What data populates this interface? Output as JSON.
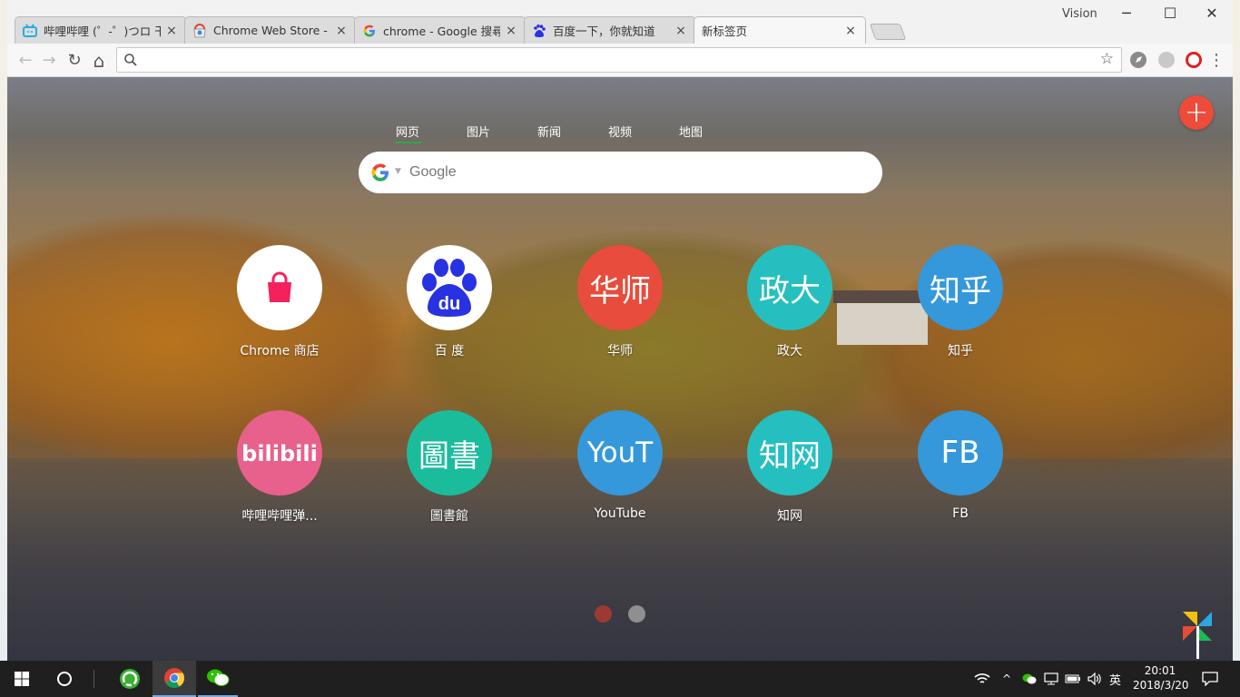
{
  "window": {
    "profile_name": "Vision",
    "controls": {
      "minimize": "─",
      "maximize": "☐",
      "close": "✕"
    }
  },
  "tabs": [
    {
      "title": "哔哩哔哩 (゜-゜)つロ 干杯",
      "icon": "bilibili-icon",
      "icon_color": "#23ade5"
    },
    {
      "title": "Chrome Web Store - ap",
      "icon": "chrome-webstore-icon",
      "icon_color": "#e0452f"
    },
    {
      "title": "chrome - Google 搜尋",
      "icon": "google-icon",
      "icon_color": "#4285f4"
    },
    {
      "title": "百度一下，你就知道",
      "icon": "baidu-paw-icon",
      "icon_color": "#2932e1"
    },
    {
      "title": "新标签页",
      "icon": "",
      "icon_color": ""
    }
  ],
  "tab_close_label": "×",
  "toolbar": {
    "back": "←",
    "forward": "→",
    "reload": "↻",
    "home": "⌂",
    "omnibox_value": "",
    "bookmark_star": "☆",
    "menu": "⋮"
  },
  "newtab": {
    "search_tabs": [
      "网页",
      "图片",
      "新闻",
      "视频",
      "地图"
    ],
    "search_placeholder": "Google",
    "add_button": "+",
    "tiles": [
      {
        "text": "",
        "label": "Chrome 商店",
        "bg": "#ffffff",
        "kind": "store"
      },
      {
        "text": "",
        "label": "百 度",
        "bg": "#ffffff",
        "kind": "baidu"
      },
      {
        "text": "华师",
        "label": "华师",
        "bg": "#e74c3c",
        "kind": "text"
      },
      {
        "text": "政大",
        "label": "政大",
        "bg": "#26bfbf",
        "kind": "text"
      },
      {
        "text": "知乎",
        "label": "知乎",
        "bg": "#3498db",
        "kind": "text"
      },
      {
        "text": "",
        "label": "哔哩哔哩弹...",
        "bg": "#e8608c",
        "kind": "bilibili"
      },
      {
        "text": "圖書",
        "label": "圖書館",
        "bg": "#1abc9c",
        "kind": "text"
      },
      {
        "text": "YouT",
        "label": "YouTube",
        "bg": "#3498db",
        "kind": "text"
      },
      {
        "text": "知网",
        "label": "知网",
        "bg": "#26bfbf",
        "kind": "text"
      },
      {
        "text": "FB",
        "label": "FB",
        "bg": "#3498db",
        "kind": "text"
      }
    ],
    "page_dots": [
      {
        "color": "#c0392b"
      },
      {
        "color": "#bdbdbd"
      }
    ]
  },
  "taskbar": {
    "language": "英",
    "time": "20:01",
    "date": "2018/3/20",
    "tray_icons": [
      "wifi-icon",
      "chevron-up-icon",
      "wechat-tray-icon",
      "network-icon",
      "battery-icon",
      "volume-icon"
    ]
  }
}
